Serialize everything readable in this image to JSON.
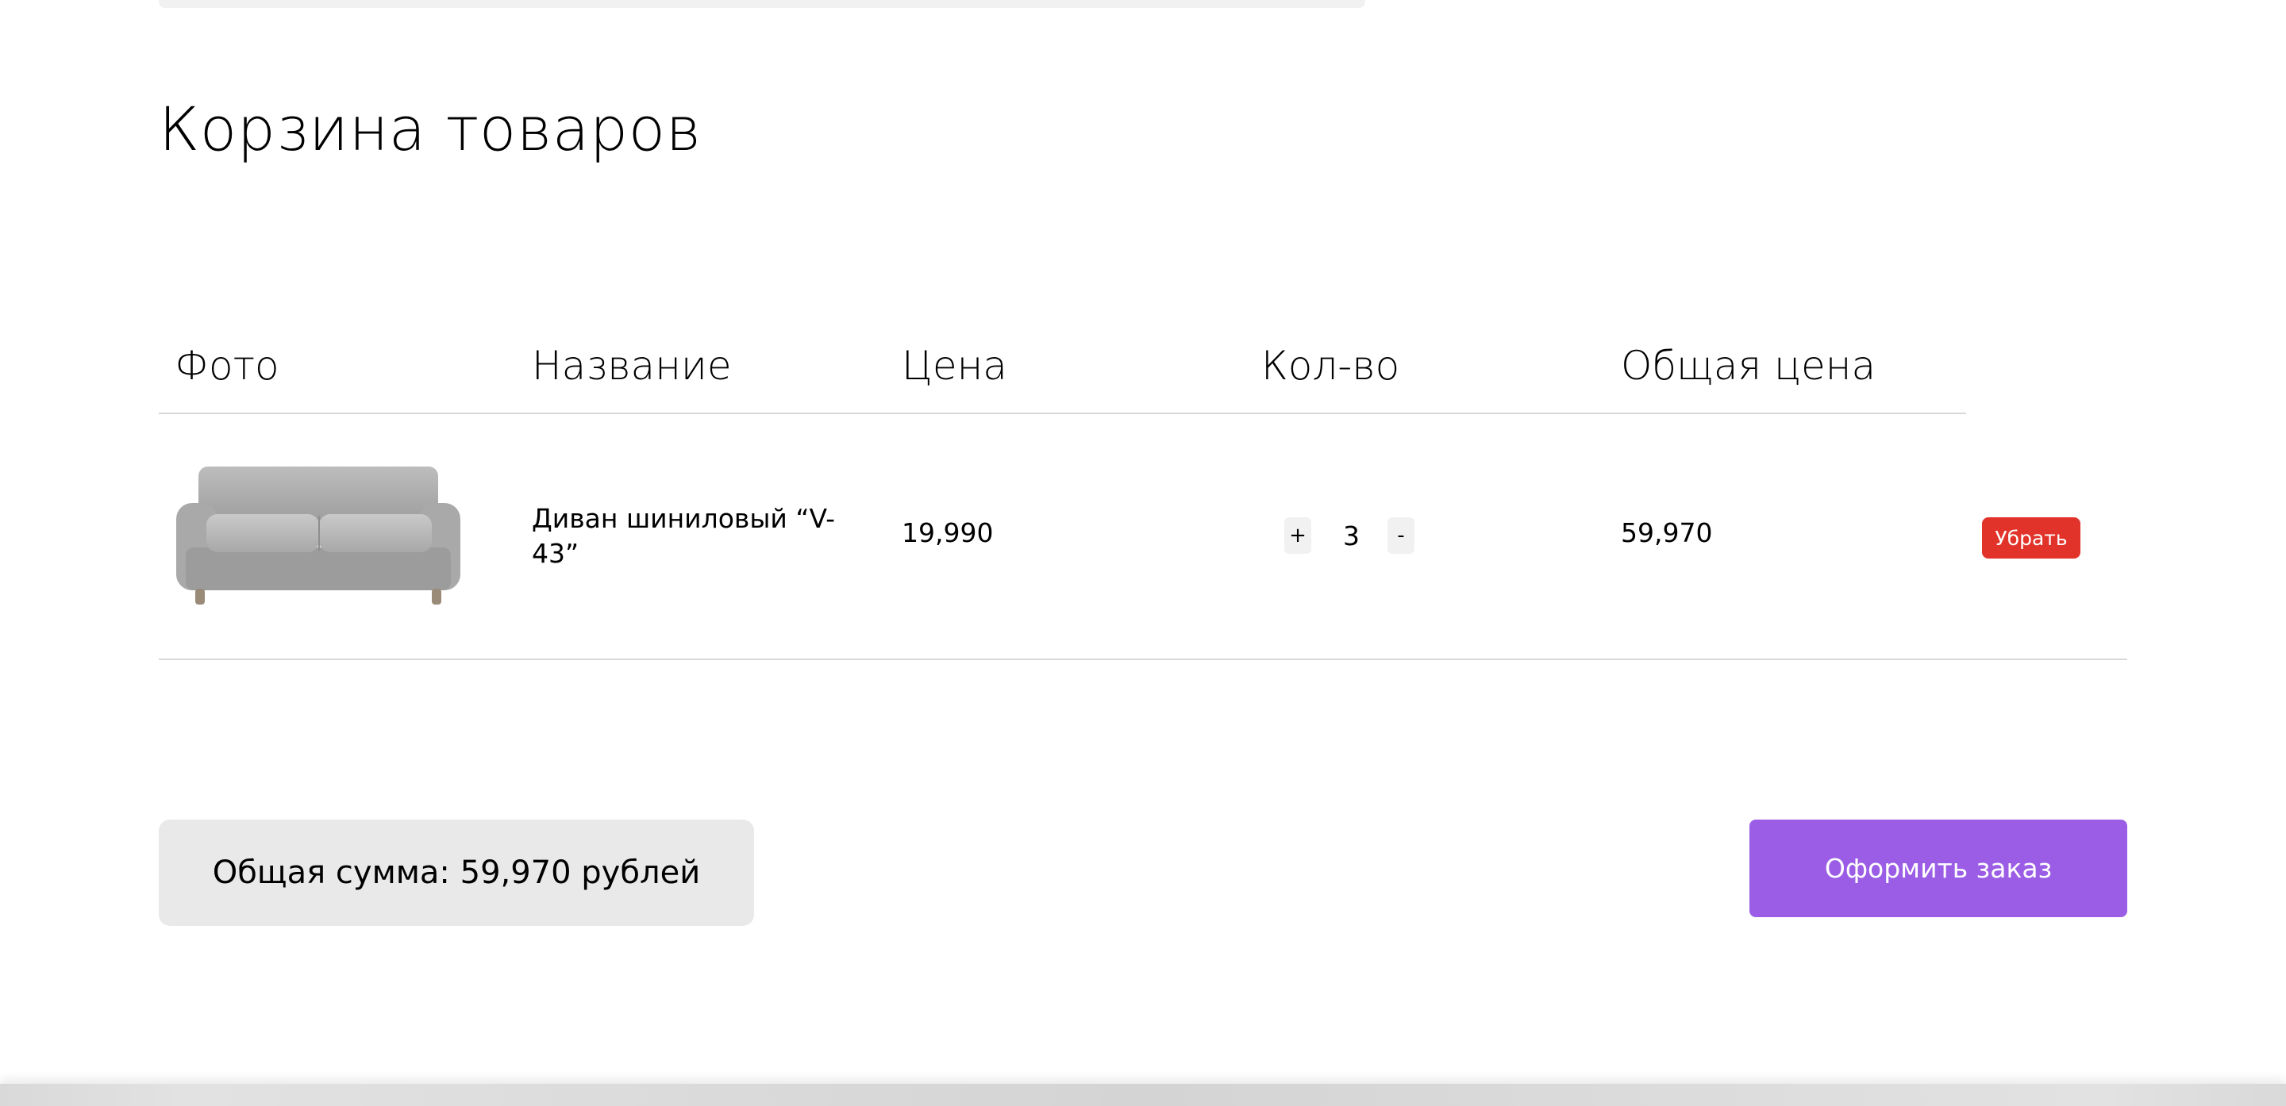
{
  "page": {
    "title": "Корзина товаров"
  },
  "table": {
    "headers": [
      "Фото",
      "Название",
      "Цена",
      "Кол-во",
      "Общая цена"
    ],
    "rows": [
      {
        "photo_icon": "sofa-image",
        "name": "Диван шиниловый “V-43”",
        "price": "19,990",
        "qty_plus_label": "+",
        "quantity": "3",
        "qty_minus_label": "-",
        "total": "59,970",
        "remove_label": "Убрать"
      }
    ]
  },
  "summary": {
    "total_text": "Общая сумма: 59,970 рублей",
    "checkout_label": "Оформить заказ"
  },
  "colors": {
    "accent": "#9b5de5",
    "danger": "#e2332a",
    "panel": "#e9e9e9",
    "divider": "#d8d8d8"
  }
}
